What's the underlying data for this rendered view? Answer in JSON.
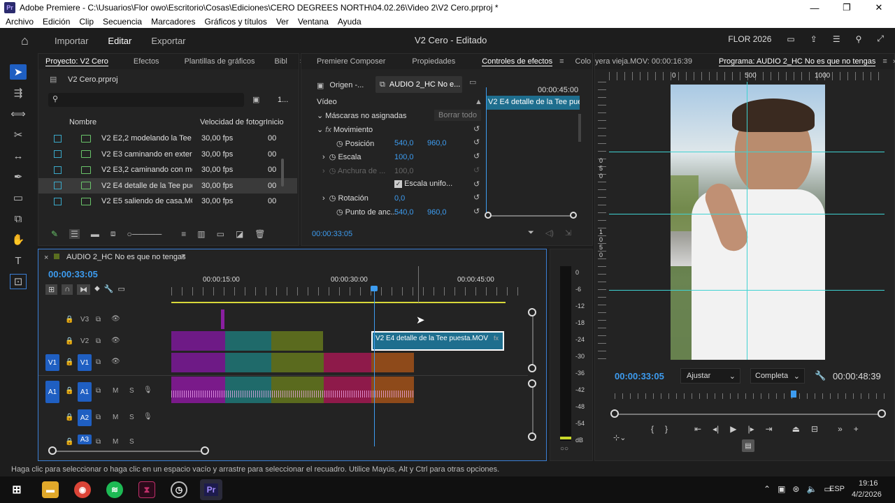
{
  "window": {
    "title": "Adobe Premiere - C:\\Usuarios\\Flor owo\\Escritorio\\Cosas\\Ediciones\\CERO DEGREES NORTH\\04.02.26\\Video 2\\V2 Cero.prproj *",
    "logo_text": "Pr",
    "minimize": "—",
    "restore": "❐",
    "close": "✕"
  },
  "menu": [
    "Archivo",
    "Edición",
    "Clip",
    "Secuencia",
    "Marcadores",
    "Gráficos y títulos",
    "Ver",
    "Ventana",
    "Ayuda"
  ],
  "header": {
    "nav": [
      "Importar",
      "Editar",
      "Exportar"
    ],
    "active": "Editar",
    "center_title": "V2 Cero - Editado",
    "workspace": "FLOR 2026"
  },
  "project_panel": {
    "tabs": [
      "Proyecto: V2 Cero",
      "Efectos",
      "Plantillas de gráficos",
      "Bibl"
    ],
    "project_file": "V2 Cero.prproj",
    "count_label": "1...",
    "columns": [
      "Nombre",
      "Velocidad de fotogr",
      "Inicio"
    ],
    "rows": [
      {
        "name": "V2 E2,2 modelando la Tee e",
        "fps": "30,00 fps",
        "start": "00"
      },
      {
        "name": "V2 E3 caminando en exterior",
        "fps": "30,00 fps",
        "start": "00"
      },
      {
        "name": "V2 E3,2 caminando con moc",
        "fps": "30,00 fps",
        "start": "00"
      },
      {
        "name": "V2 E4 detalle de la Tee puest",
        "fps": "30,00 fps",
        "start": "00"
      },
      {
        "name": "V2 E5 saliendo de casa.MOV",
        "fps": "30,00 fps",
        "start": "00"
      }
    ],
    "selected_row_index": 3
  },
  "effect_controls": {
    "tabs": [
      "Premiere Composer",
      "Propiedades",
      "Controles de efectos",
      "Colo"
    ],
    "source_tab": "Origen -...",
    "seq_tab": "AUDIO 2_HC No e...",
    "time_ruler": "00:00:45:00",
    "clip_label": "V2 E4 detalle de la Tee pues",
    "section": "Vídeo",
    "masks": "Máscaras no asignadas",
    "clear_all": "Borrar todo",
    "motion": "Movimiento",
    "position": {
      "label": "Posición",
      "x": "540,0",
      "y": "960,0"
    },
    "scale": {
      "label": "Escala",
      "value": "100,0"
    },
    "width": {
      "label": "Anchura de ...",
      "value": "100,0"
    },
    "uniform_scale": "Escala unifo...",
    "rotation": {
      "label": "Rotación",
      "value": "0,0"
    },
    "anchor": {
      "label": "Punto de anc...",
      "x": "540,0",
      "y": "960,0"
    },
    "timecode": "00:00:33:05"
  },
  "program_monitor": {
    "source_tab": "yera vieja.MOV: 00:00:16:39",
    "program_tab": "Programa: AUDIO 2_HC No es que no tengas",
    "ruler_labels": [
      "0",
      "500",
      "1000"
    ],
    "timecode": "00:00:33:05",
    "fit": "Ajustar",
    "quality": "Completa",
    "duration": "00:00:48:39",
    "side_ruler": [
      "0",
      "5",
      "0",
      "1",
      "0",
      "5",
      "0"
    ]
  },
  "timeline": {
    "sequence_name": "AUDIO 2_HC No es que no tengas",
    "timecode": "00:00:33:05",
    "ruler_labels": [
      "00:00:15:00",
      "00:00:30:00",
      "00:00:45:00"
    ],
    "tracks": {
      "v3": "V3",
      "v2": "V2",
      "v1": "V1",
      "v1_src": "V1",
      "a1": "A1",
      "a1_src": "A1",
      "a2": "A2",
      "a3": "A3",
      "m": "M",
      "s": "S"
    },
    "selected_clip": "V2 E4 detalle de la Tee puesta.MOV",
    "selected_clip_fx": "fx"
  },
  "meters": {
    "scale": [
      "0",
      "-6",
      "-12",
      "-18",
      "-24",
      "-30",
      "-36",
      "-42",
      "-48",
      "-54",
      "dB"
    ]
  },
  "status_bar": "Haga clic para seleccionar o haga clic en un espacio vacío y arrastre para seleccionar el recuadro. Utilice Mayús, Alt y Ctrl para otras opciones.",
  "taskbar": {
    "lang": "ESP",
    "time": "19:16",
    "date": "4/2/2026",
    "premiere": "Pr"
  },
  "colors": {
    "accent": "#1f5fc2",
    "selection_border": "#3a7fd6",
    "guide": "#3fd2d2",
    "value_blue": "#3d9cf0"
  }
}
